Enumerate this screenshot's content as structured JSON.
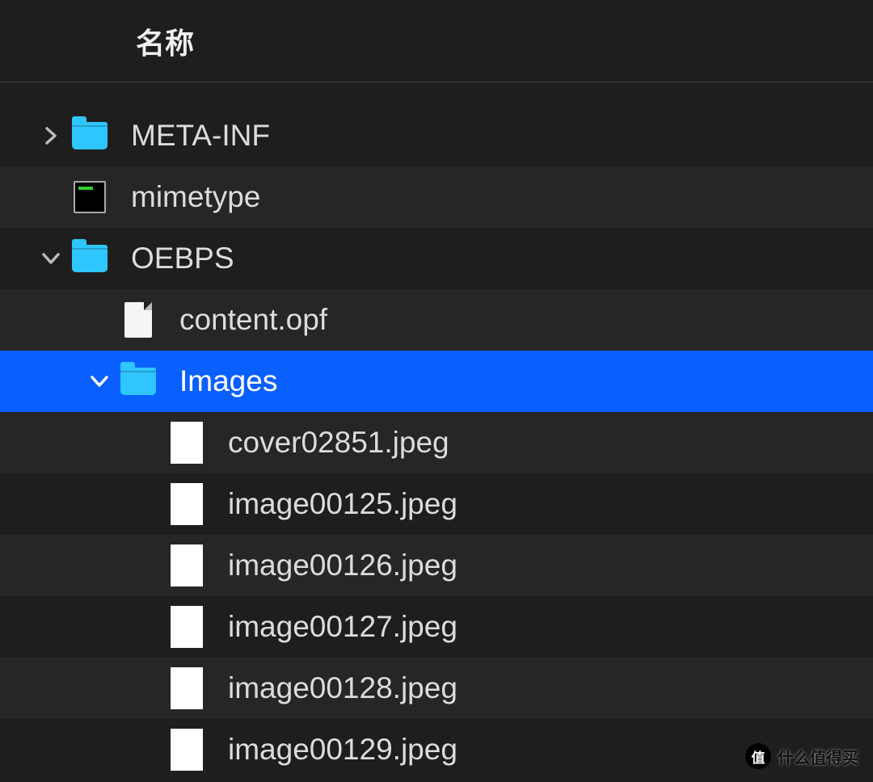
{
  "header": {
    "title": "名称"
  },
  "tree": [
    {
      "id": "meta-inf",
      "label": "META-INF",
      "kind": "folder",
      "depth": 0,
      "disclosure": "right",
      "selected": false,
      "alt": false
    },
    {
      "id": "mimetype",
      "label": "mimetype",
      "kind": "terminal",
      "depth": 0,
      "disclosure": "none",
      "selected": false,
      "alt": true
    },
    {
      "id": "oebps",
      "label": "OEBPS",
      "kind": "folder",
      "depth": 0,
      "disclosure": "down",
      "selected": false,
      "alt": false
    },
    {
      "id": "content",
      "label": "content.opf",
      "kind": "file",
      "depth": 1,
      "disclosure": "none",
      "selected": false,
      "alt": true
    },
    {
      "id": "images",
      "label": "Images",
      "kind": "folder",
      "depth": 1,
      "disclosure": "down",
      "selected": true,
      "alt": false
    },
    {
      "id": "cover",
      "label": "cover02851.jpeg",
      "kind": "thumb",
      "thumb": "cover",
      "depth": 2,
      "disclosure": "none",
      "selected": false,
      "alt": true
    },
    {
      "id": "img125",
      "label": "image00125.jpeg",
      "kind": "thumb",
      "thumb": "page1",
      "depth": 2,
      "disclosure": "none",
      "selected": false,
      "alt": false
    },
    {
      "id": "img126",
      "label": "image00126.jpeg",
      "kind": "thumb",
      "thumb": "bw",
      "depth": 2,
      "disclosure": "none",
      "selected": false,
      "alt": true
    },
    {
      "id": "img127",
      "label": "image00127.jpeg",
      "kind": "thumb",
      "thumb": "bw",
      "depth": 2,
      "disclosure": "none",
      "selected": false,
      "alt": false
    },
    {
      "id": "img128",
      "label": "image00128.jpeg",
      "kind": "thumb",
      "thumb": "bw",
      "depth": 2,
      "disclosure": "none",
      "selected": false,
      "alt": true
    },
    {
      "id": "img129",
      "label": "image00129.jpeg",
      "kind": "thumb",
      "thumb": "bw",
      "depth": 2,
      "disclosure": "none",
      "selected": false,
      "alt": false
    }
  ],
  "watermark": {
    "badge": "值",
    "text": "什么值得买"
  }
}
